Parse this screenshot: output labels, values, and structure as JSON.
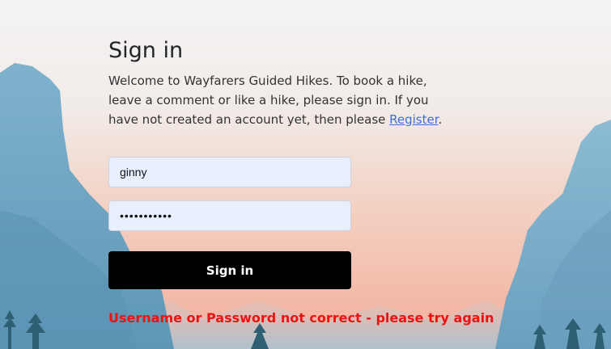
{
  "login": {
    "title": "Sign in",
    "intro_text": "Welcome to Wayfarers Guided Hikes. To book a hike, leave a comment or like a hike, please sign in. If you have not created an account yet, then please ",
    "register_link": "Register",
    "intro_end": ".",
    "username_value": "ginny",
    "password_value": "ginnyginny1",
    "submit_label": "Sign in",
    "error_message": "Username or Password not correct - please try again"
  },
  "colors": {
    "button_background": "#000000",
    "error_text": "#ee1111",
    "link": "#3f6fd6",
    "input_background": "#e8f0fe"
  }
}
